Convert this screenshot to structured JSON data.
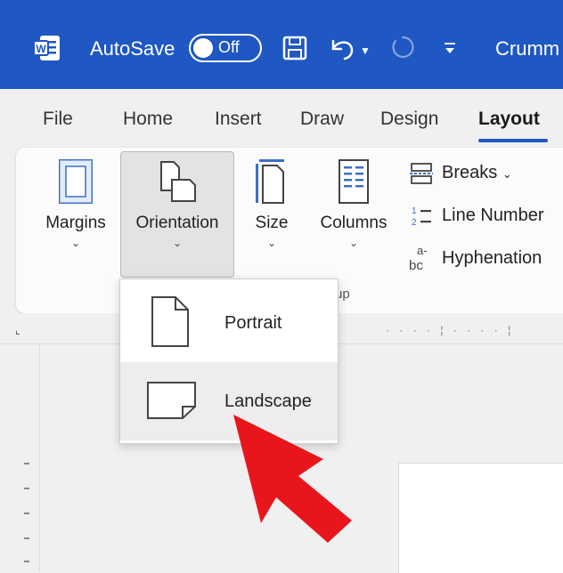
{
  "titlebar": {
    "autosave_label": "AutoSave",
    "toggle_state": "Off",
    "document_name": "Crumm"
  },
  "tabs": [
    "File",
    "Home",
    "Insert",
    "Draw",
    "Design",
    "Layout"
  ],
  "active_tab": "Layout",
  "ribbon": {
    "margins": "Margins",
    "orientation": "Orientation",
    "size": "Size",
    "columns": "Columns",
    "breaks": "Breaks",
    "line_numbers": "Line Number",
    "hyphenation": "Hyphenation",
    "group_label_fragment": "up"
  },
  "orientation_menu": {
    "portrait": "Portrait",
    "landscape": "Landscape"
  },
  "colors": {
    "titlebar": "#1f57c3",
    "accent": "#1f57c3",
    "annotation_arrow": "#e8161c"
  }
}
